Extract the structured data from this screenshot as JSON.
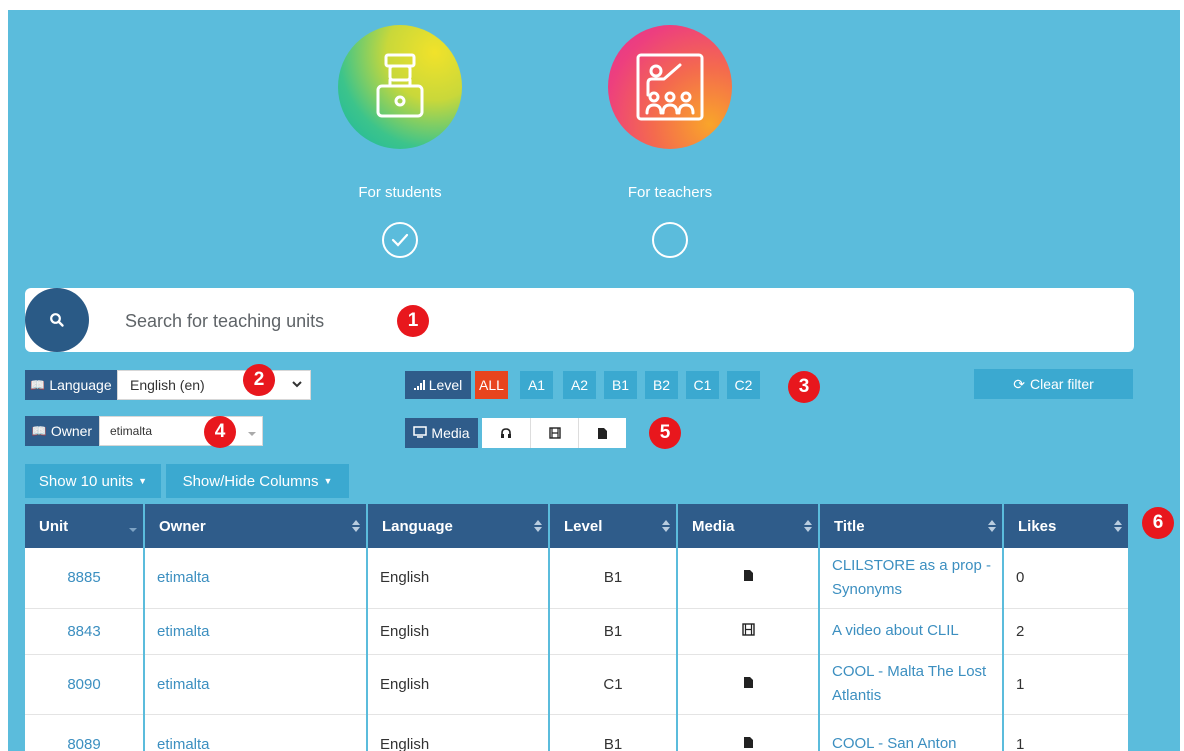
{
  "hero": {
    "students_label": "For students",
    "teachers_label": "For teachers",
    "students_selected": true,
    "teachers_selected": false
  },
  "search": {
    "placeholder": "Search for teaching units"
  },
  "badges": [
    "1",
    "2",
    "3",
    "4",
    "5",
    "6"
  ],
  "filters": {
    "language_label": "Language",
    "language_value": "English (en)",
    "owner_label": "Owner",
    "owner_value": "etimalta",
    "level_label": "Level",
    "levels": [
      "ALL",
      "A1",
      "A2",
      "B1",
      "B2",
      "C1",
      "C2"
    ],
    "level_selected": "ALL",
    "media_label": "Media",
    "media_options": [
      "audio-icon",
      "video-icon",
      "document-icon"
    ],
    "clear_label": "Clear filter"
  },
  "toolbar": {
    "show_units_label": "Show 10 units",
    "show_hide_label": "Show/Hide Columns"
  },
  "table": {
    "columns": [
      "Unit",
      "Owner",
      "Language",
      "Level",
      "Media",
      "Title",
      "Likes"
    ],
    "rows": [
      {
        "unit": "8885",
        "owner": "etimalta",
        "language": "English",
        "level": "B1",
        "media": "document-icon",
        "title": "CLILSTORE as a prop - Synonyms",
        "likes": "0"
      },
      {
        "unit": "8843",
        "owner": "etimalta",
        "language": "English",
        "level": "B1",
        "media": "video-icon",
        "title": "A video about CLIL",
        "likes": "2"
      },
      {
        "unit": "8090",
        "owner": "etimalta",
        "language": "English",
        "level": "C1",
        "media": "document-icon",
        "title": "COOL - Malta The Lost Atlantis",
        "likes": "1"
      },
      {
        "unit": "8089",
        "owner": "etimalta",
        "language": "English",
        "level": "B1",
        "media": "document-icon",
        "title": "COOL - San Anton",
        "likes": "1"
      }
    ]
  },
  "colors": {
    "background": "#5bbcdc",
    "dark_blue": "#2f5c8a",
    "button_blue": "#3ba9d0",
    "active_level": "#e8451e",
    "badge_red": "#e8171d"
  }
}
